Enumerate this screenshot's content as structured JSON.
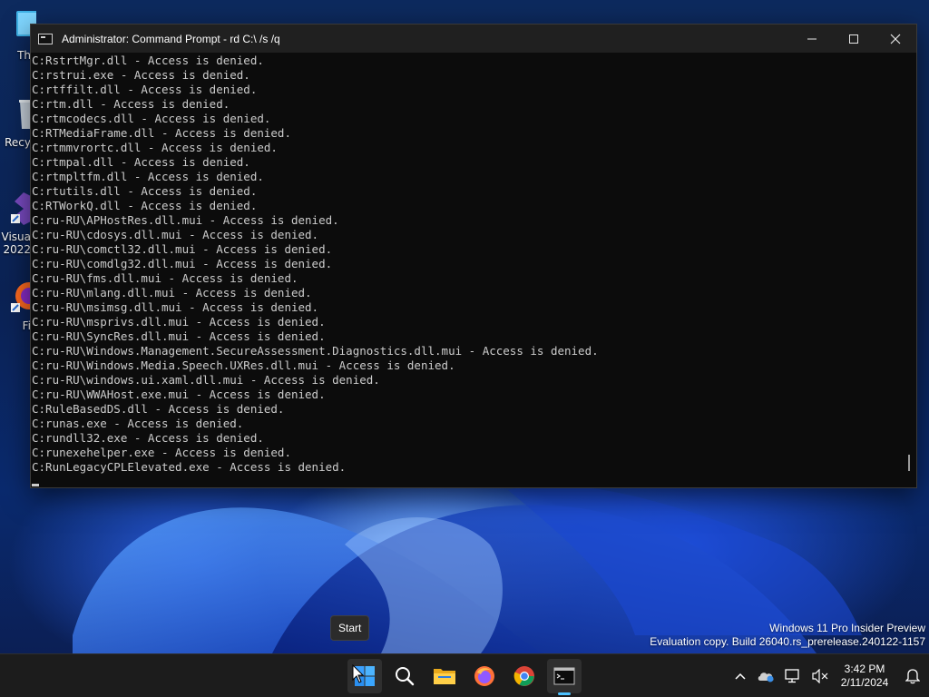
{
  "window": {
    "title": "Administrator: Command Prompt - rd  C:\\ /s /q",
    "controls": {
      "minimize": "minimize",
      "maximize": "maximize",
      "close": "close"
    }
  },
  "console": {
    "lines": [
      "C:RstrtMgr.dll - Access is denied.",
      "C:rstrui.exe - Access is denied.",
      "C:rtffilt.dll - Access is denied.",
      "C:rtm.dll - Access is denied.",
      "C:rtmcodecs.dll - Access is denied.",
      "C:RTMediaFrame.dll - Access is denied.",
      "C:rtmmvrortc.dll - Access is denied.",
      "C:rtmpal.dll - Access is denied.",
      "C:rtmpltfm.dll - Access is denied.",
      "C:rtutils.dll - Access is denied.",
      "C:RTWorkQ.dll - Access is denied.",
      "C:ru-RU\\APHostRes.dll.mui - Access is denied.",
      "C:ru-RU\\cdosys.dll.mui - Access is denied.",
      "C:ru-RU\\comctl32.dll.mui - Access is denied.",
      "C:ru-RU\\comdlg32.dll.mui - Access is denied.",
      "C:ru-RU\\fms.dll.mui - Access is denied.",
      "C:ru-RU\\mlang.dll.mui - Access is denied.",
      "C:ru-RU\\msimsg.dll.mui - Access is denied.",
      "C:ru-RU\\msprivs.dll.mui - Access is denied.",
      "C:ru-RU\\SyncRes.dll.mui - Access is denied.",
      "C:ru-RU\\Windows.Management.SecureAssessment.Diagnostics.dll.mui - Access is denied.",
      "C:ru-RU\\Windows.Media.Speech.UXRes.dll.mui - Access is denied.",
      "C:ru-RU\\windows.ui.xaml.dll.mui - Access is denied.",
      "C:ru-RU\\WWAHost.exe.mui - Access is denied.",
      "C:RuleBasedDS.dll - Access is denied.",
      "C:runas.exe - Access is denied.",
      "C:rundll32.exe - Access is denied.",
      "C:runexehelper.exe - Access is denied.",
      "C:RunLegacyCPLElevated.exe - Access is denied."
    ]
  },
  "desktop": {
    "icons": [
      {
        "label": "Th",
        "icon": "this-pc-icon"
      },
      {
        "label": "Recy",
        "icon": "recycle-bin-icon"
      },
      {
        "label": "Visua",
        "label2": "2022",
        "icon": "visual-studio-icon"
      },
      {
        "label": "Fi",
        "icon": "firefox-icon"
      }
    ]
  },
  "watermark": {
    "line1": "Windows 11 Pro Insider Preview",
    "line2": "Evaluation copy. Build 26040.rs_prerelease.240122-1157"
  },
  "tooltip": {
    "text": "Start"
  },
  "taskbar": {
    "apps": [
      "start-icon",
      "search-icon",
      "file-explorer-icon",
      "firefox-icon",
      "chrome-icon",
      "terminal-icon"
    ],
    "tray": [
      "chevron-up-icon",
      "onedrive-icon",
      "network-icon",
      "volume-muted-icon",
      "notifications-icon"
    ],
    "time": "3:42 PM",
    "date": "2/11/2024"
  },
  "colors": {
    "accent": "#4cc2ff",
    "console_bg": "#0c0c0c",
    "console_text": "#cccccc",
    "titlebar_bg": "#202020",
    "taskbar_bg": "#1c1c1c"
  }
}
